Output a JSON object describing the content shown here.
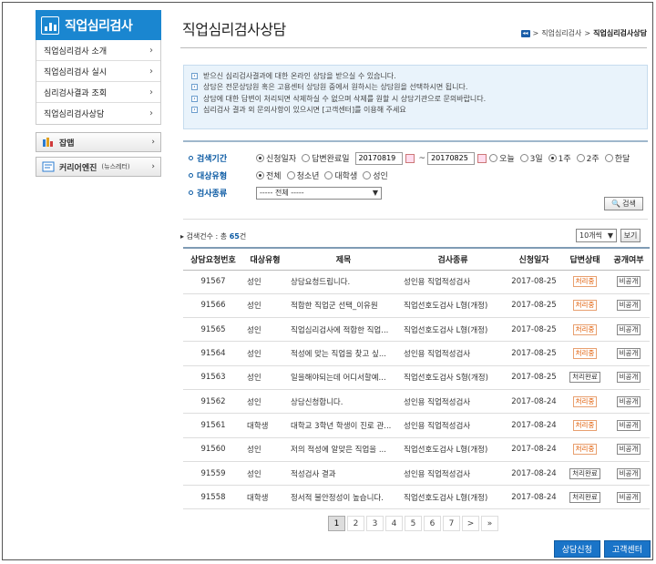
{
  "sidebar": {
    "title": "직업심리검사",
    "items": [
      {
        "label": "직업심리검사 소개"
      },
      {
        "label": "직업심리검사 실시"
      },
      {
        "label": "심리검사결과 조회"
      },
      {
        "label": "직업심리검사상담"
      }
    ],
    "jobmap": "잡맵",
    "career": "커리어엔진",
    "career_sub": "(뉴스레터)",
    "chevron": "›"
  },
  "page": {
    "title": "직업심리검사상담",
    "breadcrumb": [
      "직업심리검사",
      "직업심리검사상담"
    ],
    "sep": ">"
  },
  "notice": [
    "받으신 심리검사결과에 대한 온라인 상담을 받으실 수 있습니다.",
    "상담은 전문상담원 혹은 고용센터 상담원 중에서 원하시는 상담원을 선택하시면 됩니다.",
    "상담에 대한 답변이 처리되면 삭제하실 수 없으며 삭제를 원할 시 상담기관으로 문의바랍니다.",
    "심리검사 결과 외 문의사항이 있으시면 [고객센터]를 이용해 주세요"
  ],
  "search": {
    "period_label": "검색기간",
    "period_opts": [
      "신청일자",
      "답변완료일"
    ],
    "date_from": "20170819",
    "date_to": "20170825",
    "tilde": "~",
    "quick": [
      "오늘",
      "3일",
      "1주",
      "2주",
      "한달"
    ],
    "target_label": "대상유형",
    "targets": [
      "전체",
      "청소년",
      "대학생",
      "성인"
    ],
    "type_label": "검사종류",
    "type_value": "----- 전체 -----",
    "search_btn": "검색"
  },
  "result": {
    "prefix": "검색건수 : 총",
    "count": "65",
    "suffix": "건",
    "perpage": "10개씩",
    "view_btn": "보기"
  },
  "table": {
    "headers": [
      "상담요청번호",
      "대상유형",
      "제목",
      "검사종류",
      "신청일자",
      "답변상태",
      "공개여부"
    ],
    "rows": [
      [
        "91567",
        "성인",
        "상담요청드립니다.",
        "성인용 직업적성검사",
        "2017-08-25",
        "처리중",
        "비공개"
      ],
      [
        "91566",
        "성인",
        "적합한 직업군 선택_이유원",
        "직업선호도검사 L형(개정)",
        "2017-08-25",
        "처리중",
        "비공개"
      ],
      [
        "91565",
        "성인",
        "직업심리검사에 적합한 직업...",
        "직업선호도검사 L형(개정)",
        "2017-08-25",
        "처리중",
        "비공개"
      ],
      [
        "91564",
        "성인",
        "적성에 맞는 직업을 찾고 싶...",
        "성인용 직업적성검사",
        "2017-08-25",
        "처리중",
        "비공개"
      ],
      [
        "91563",
        "성인",
        "일을해야되는데 어디서할예...",
        "직업선호도검사 S형(개정)",
        "2017-08-25",
        "처리완료",
        "비공개"
      ],
      [
        "91562",
        "성인",
        "상담신청합니다.",
        "성인용 직업적성검사",
        "2017-08-24",
        "처리중",
        "비공개"
      ],
      [
        "91561",
        "대학생",
        "대학교 3학년 학생이 진로 관...",
        "성인용 직업적성검사",
        "2017-08-24",
        "처리중",
        "비공개"
      ],
      [
        "91560",
        "성인",
        "저의 적성에 알맞은 직업을 ...",
        "직업선호도검사 L형(개정)",
        "2017-08-24",
        "처리중",
        "비공개"
      ],
      [
        "91559",
        "성인",
        "적성검사 결과",
        "성인용 직업적성검사",
        "2017-08-24",
        "처리완료",
        "비공개"
      ],
      [
        "91558",
        "대학생",
        "정서적 불안정성이 높습니다.",
        "직업선호도검사 L형(개정)",
        "2017-08-24",
        "처리완료",
        "비공개"
      ]
    ]
  },
  "pager": {
    "pages": [
      "1",
      "2",
      "3",
      "4",
      "5",
      "6",
      "7"
    ],
    "next": ">",
    "last": "»"
  },
  "buttons": {
    "apply": "상담신청",
    "support": "고객센터"
  },
  "colors": {
    "brand": "#1a86d0",
    "label_blue": "#0b5aa3",
    "processing": "#e05a00"
  }
}
